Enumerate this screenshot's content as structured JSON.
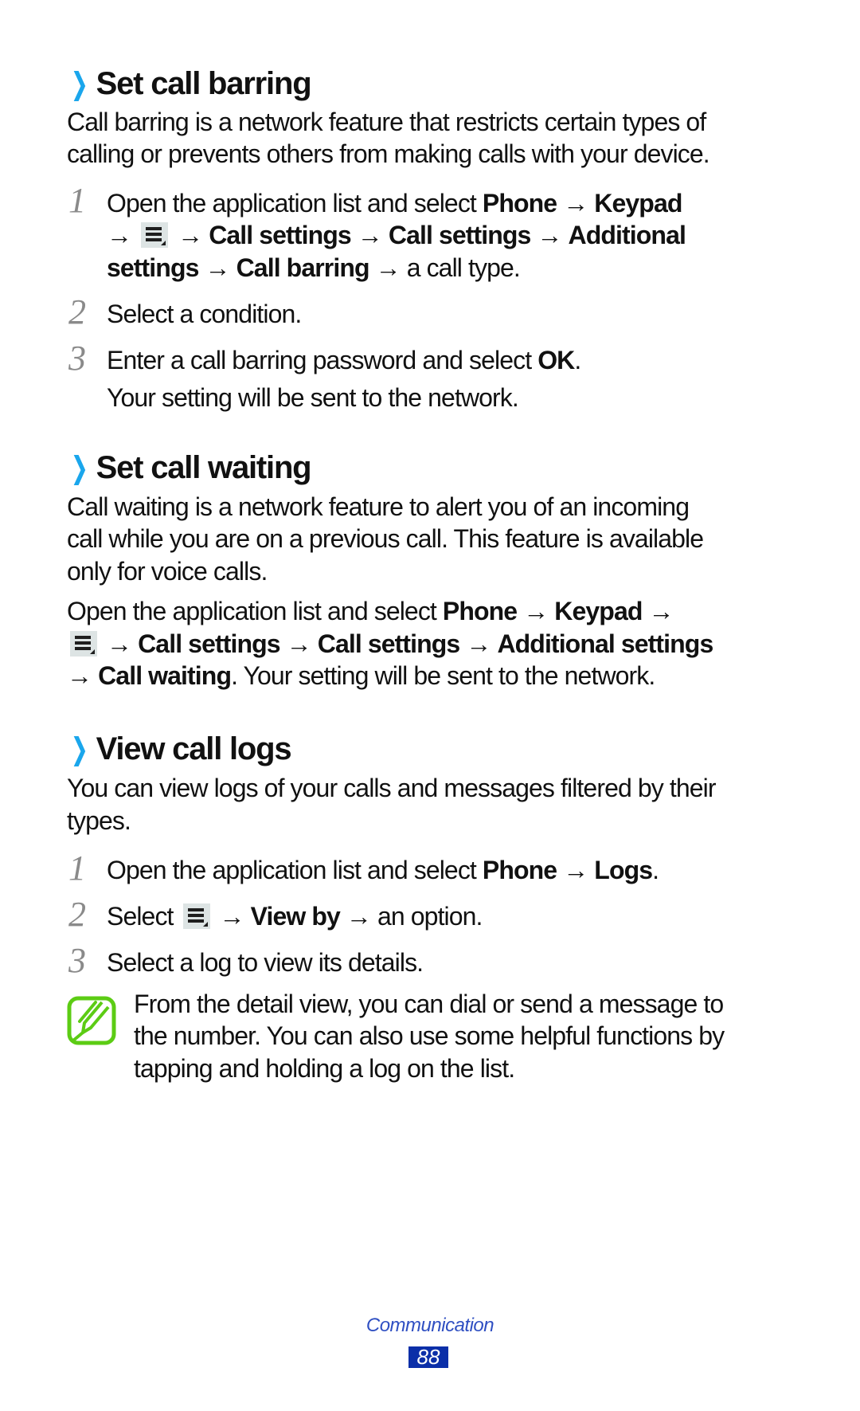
{
  "sections": [
    {
      "heading": "Set call barring",
      "intro": [
        "Call barring is a network feature that restricts certain types of",
        "calling or prevents others from making calls with your device."
      ],
      "steps": [
        {
          "number": "1",
          "lines": [
            [
              {
                "t": "Open the application list and select "
              },
              {
                "b": "Phone"
              },
              {
                "t": " → "
              },
              {
                "b": "Keypad"
              }
            ],
            [
              {
                "t": "→ "
              },
              {
                "icon": "menu"
              },
              {
                "t": " → "
              },
              {
                "b": "Call settings"
              },
              {
                "t": " → "
              },
              {
                "b": "Call settings"
              },
              {
                "t": " → "
              },
              {
                "b": "Additional"
              }
            ],
            [
              {
                "b": "settings"
              },
              {
                "t": " → "
              },
              {
                "b": "Call barring"
              },
              {
                "t": " → a call type."
              }
            ]
          ]
        },
        {
          "number": "2",
          "lines": [
            [
              {
                "t": "Select a condition."
              }
            ]
          ]
        },
        {
          "number": "3",
          "lines": [
            [
              {
                "t": "Enter a call barring password and select "
              },
              {
                "b": "OK"
              },
              {
                "t": "."
              }
            ],
            [
              {
                "t": "Your setting will be sent to the network."
              }
            ]
          ]
        }
      ]
    },
    {
      "heading": "Set call waiting",
      "intro": [
        "Call waiting is a network feature to alert you of an incoming",
        "call while you are on a previous call. This feature is available",
        "only for voice calls."
      ],
      "paragraph": [
        [
          {
            "t": "Open the application list and select "
          },
          {
            "b": "Phone"
          },
          {
            "t": " → "
          },
          {
            "b": "Keypad"
          },
          {
            "t": " →"
          }
        ],
        [
          {
            "icon": "menu"
          },
          {
            "t": " → "
          },
          {
            "b": "Call settings"
          },
          {
            "t": " → "
          },
          {
            "b": "Call settings"
          },
          {
            "t": " → "
          },
          {
            "b": "Additional settings"
          }
        ],
        [
          {
            "t": "→ "
          },
          {
            "b": "Call waiting"
          },
          {
            "t": ". Your setting will be sent to the network."
          }
        ]
      ]
    },
    {
      "heading": "View call logs",
      "intro": [
        "You can view logs of your calls and messages filtered by their",
        "types."
      ],
      "steps": [
        {
          "number": "1",
          "lines": [
            [
              {
                "t": "Open the application list and select "
              },
              {
                "b": "Phone"
              },
              {
                "t": " → "
              },
              {
                "b": "Logs"
              },
              {
                "t": "."
              }
            ]
          ]
        },
        {
          "number": "2",
          "lines": [
            [
              {
                "t": "Select "
              },
              {
                "icon": "menu"
              },
              {
                "t": " → "
              },
              {
                "b": "View by"
              },
              {
                "t": " → an option."
              }
            ]
          ]
        },
        {
          "number": "3",
          "lines": [
            [
              {
                "t": "Select a log to view its details."
              }
            ]
          ]
        }
      ],
      "note": [
        "From the detail view, you can dial or send a message to",
        "the number. You can also use some helpful functions by",
        "tapping and holding a log on the list."
      ]
    }
  ],
  "footer": {
    "section_name": "Communication",
    "page_number": "88"
  },
  "colors": {
    "chevron": "#1aa6ec",
    "note_icon": "#5ccc14",
    "footer_text": "#2f4fc2",
    "page_badge": "#0b2fa8"
  }
}
